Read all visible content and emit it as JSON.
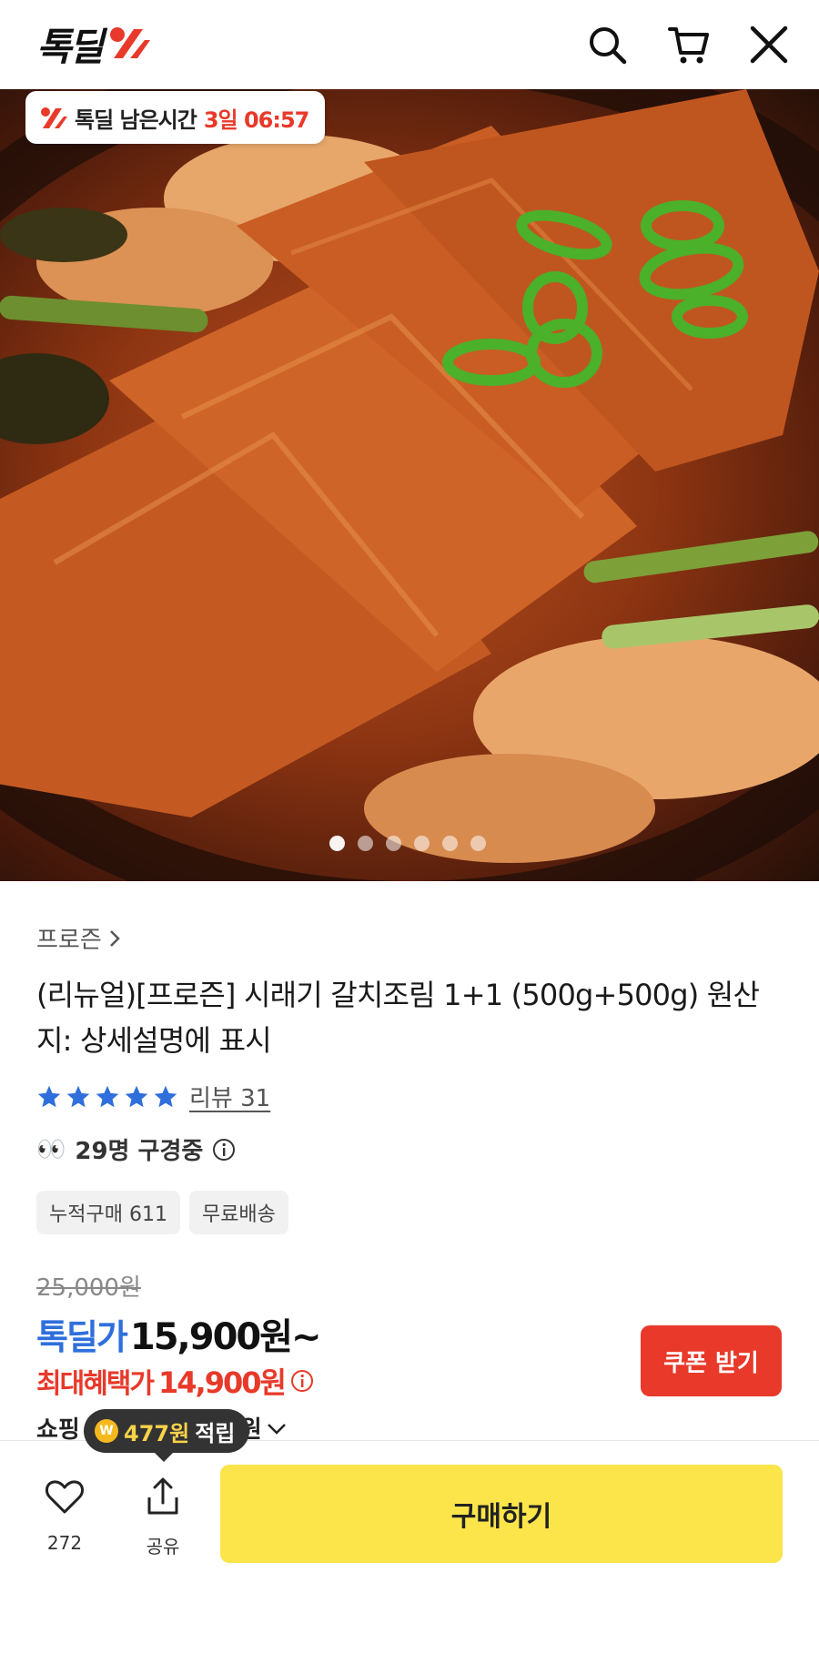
{
  "header": {
    "logo_text": "톡딜",
    "icons": [
      "search-icon",
      "cart-icon",
      "close-icon"
    ]
  },
  "hero": {
    "timer_label": "톡딜 남은시간",
    "timer_value": "3일 06:57",
    "page_dots": 6,
    "active_dot": 0
  },
  "product": {
    "category": "프로즌",
    "title": "(리뉴얼)[프로즌] 시래기 갈치조림 1+1 (500g+500g) 원산지: 상세설명에 표시",
    "rating_stars": 5,
    "review_text": "리뷰 31",
    "watching_eyes": "👀",
    "watching_text": "29명 구경중",
    "chips": [
      "누적구매 611",
      "무료배송"
    ]
  },
  "price": {
    "original": "25,000원",
    "deal_label": "톡딜가",
    "deal_price": "15,900원~",
    "benefit_label": "최대혜택가",
    "benefit_price": "14,900원",
    "coupon_button": "쿠폰 받기",
    "shopping_text_left": "쇼핑",
    "shopping_text_right": "0원"
  },
  "points_tooltip": {
    "amount": "477원",
    "text": "적립"
  },
  "bottom_bar": {
    "like_count": "272",
    "share_label": "공유",
    "buy_button": "구매하기"
  },
  "colors": {
    "deal_blue": "#2f6fdc",
    "accent_red": "#e8392a",
    "buy_yellow": "#fbe54a"
  }
}
